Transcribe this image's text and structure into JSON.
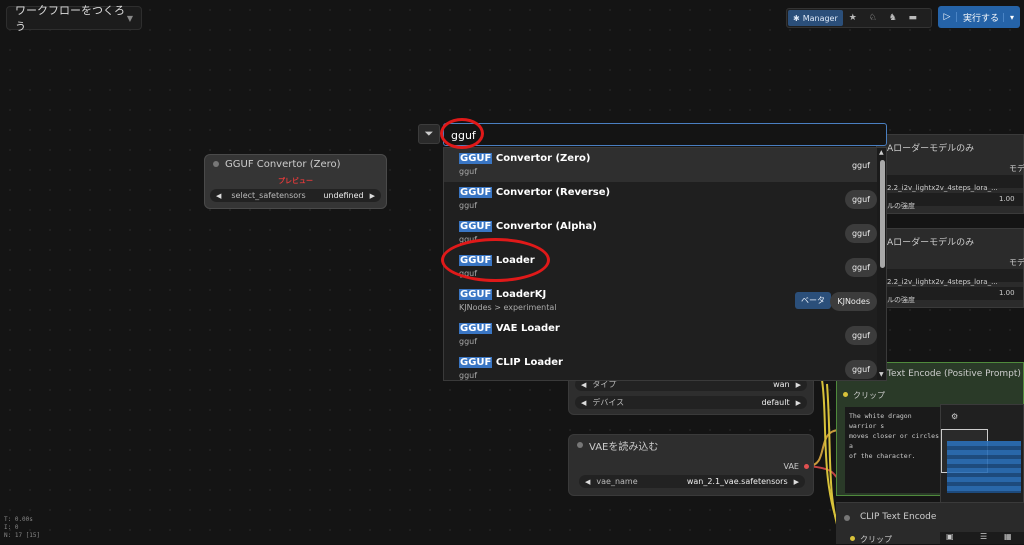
{
  "header": {
    "workflow_title": "ワークフローをつくろう",
    "manager_label": "Manager",
    "run_label": "実行する"
  },
  "gguf_node": {
    "title": "GGUF Convertor (Zero)",
    "preview_label": "プレビュー",
    "widget_name": "select_safetensors",
    "widget_value": "undefined"
  },
  "search": {
    "query": "gguf",
    "results": [
      {
        "highlight": "GGUF",
        "name": " Convertor (Zero)",
        "category": "gguf",
        "badge": "gguf"
      },
      {
        "highlight": "GGUF",
        "name": " Convertor (Reverse)",
        "category": "gguf",
        "badge": "gguf"
      },
      {
        "highlight": "GGUF",
        "name": " Convertor (Alpha)",
        "category": "gguf",
        "badge": "gguf"
      },
      {
        "highlight": "GGUF",
        "name": " Loader",
        "category": "gguf",
        "badge": "gguf"
      },
      {
        "highlight": "GGUF",
        "name": " LoaderKJ",
        "category": "KJNodes > experimental",
        "badge": "KJNodes",
        "beta": "ベータ"
      },
      {
        "highlight": "GGUF",
        "name": " VAE Loader",
        "category": "gguf",
        "badge": "gguf"
      },
      {
        "highlight": "GGUF",
        "name": " CLIP Loader",
        "category": "gguf",
        "badge": "gguf"
      }
    ]
  },
  "right_panels": {
    "lora1_title": "Aローダーモデルのみ",
    "lora1_col": "モデ",
    "lora1_value": "2.2_i2v_lightx2v_4steps_lora_...",
    "lora1_strength_label": "ルの強度",
    "lora1_strength": "1.00",
    "lora2_title": "Aローダーモデルのみ",
    "lora2_col": "モデ",
    "lora2_value": "2.2_i2v_lightx2v_4steps_lora_...",
    "lora2_strength_label": "ルの強度",
    "lora2_strength": "1.00"
  },
  "clip_loader_node": {
    "type_label": "タイプ",
    "type_value": "wan",
    "device_label": "デバイス",
    "device_value": "default"
  },
  "vae_node": {
    "title": "VAEを読み込む",
    "output_label": "VAE",
    "widget_name": "vae_name",
    "widget_value": "wan_2.1_vae.safetensors"
  },
  "text_encode_pos": {
    "title": "Text Encode (Positive Prompt)",
    "input_label": "クリップ",
    "prompt_lines": [
      "The white dragon warrior s",
      "moves closer or circles a",
      "of the character."
    ]
  },
  "text_encode_neg": {
    "title": "CLIP Text Encode",
    "input_label": "クリップ"
  },
  "stats": {
    "line1": "T: 0.00s",
    "line2": "I: 0",
    "line3": "N: 17 [15]"
  },
  "colors": {
    "accent": "#3a76c4",
    "annotation": "#e01919",
    "run_button": "#2563a8"
  }
}
